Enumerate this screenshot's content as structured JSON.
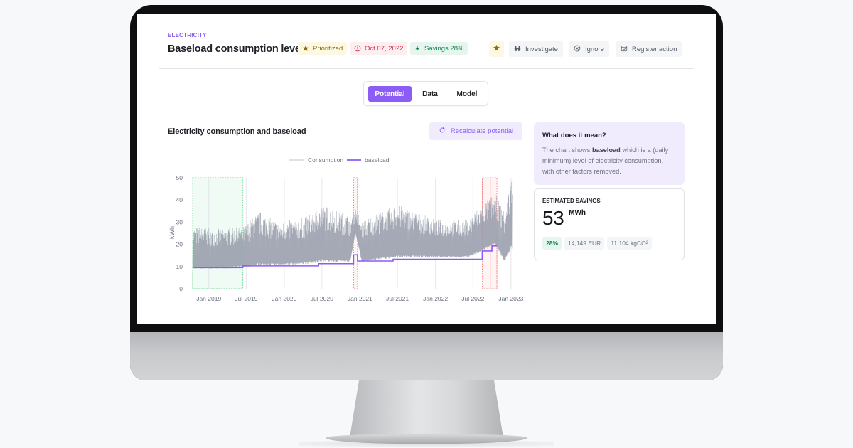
{
  "header": {
    "category": "ELECTRICITY",
    "title": "Baseload consumption level",
    "badges": {
      "prioritized": "Prioritized",
      "date": "Oct 07, 2022",
      "savings": "Savings 28%"
    },
    "actions": {
      "investigate": "Investigate",
      "ignore": "Ignore",
      "register": "Register action"
    }
  },
  "tabs": {
    "potential": "Potential",
    "data": "Data",
    "model": "Model",
    "active": "Potential"
  },
  "chart_panel": {
    "title": "Electricity consumption and baseload",
    "recalc_label": "Recalculate potential"
  },
  "info": {
    "title": "What does it mean?",
    "text_before": "The chart shows ",
    "text_bold": "baseload",
    "text_after": " which is a (daily minimum) level of electricity consumption, with other factors removed."
  },
  "savings": {
    "label": "ESTIMATED SAVINGS",
    "value": "53",
    "unit": "MWh",
    "percent": "28%",
    "eur": "14,149 EUR",
    "co2_value": "11,104 kgCO",
    "co2_sup": "2"
  },
  "colors": {
    "accent": "#8b5cf6",
    "consumption": "#9aa0ad",
    "baseline_region": "#22c55e",
    "anomaly_region": "#ef4444"
  },
  "chart_data": {
    "type": "line",
    "title": "Electricity consumption and baseload",
    "ylabel": "kWh",
    "xlabel": "",
    "ylim": [
      0,
      50
    ],
    "xlim": [
      "2018-10-15",
      "2023-01-05"
    ],
    "yticks": [
      "0",
      "10",
      "20",
      "30",
      "40",
      "50"
    ],
    "xticks": [
      {
        "label": "Jan 2019",
        "date": "2019-01-01"
      },
      {
        "label": "Jul 2019",
        "date": "2019-07-01"
      },
      {
        "label": "Jan 2020",
        "date": "2020-01-01"
      },
      {
        "label": "Jul 2020",
        "date": "2020-07-01"
      },
      {
        "label": "Jan 2021",
        "date": "2021-01-01"
      },
      {
        "label": "Jul 2021",
        "date": "2021-07-01"
      },
      {
        "label": "Jan 2022",
        "date": "2022-01-01"
      },
      {
        "label": "Jul 2022",
        "date": "2022-07-01"
      },
      {
        "label": "Jan 2023",
        "date": "2023-01-01"
      }
    ],
    "grid": "vertical",
    "legend": {
      "position": "top-center",
      "entries": [
        "Consumption",
        "baseload"
      ]
    },
    "series": [
      {
        "name": "Consumption",
        "note": "hourly consumption envelope (approx. min/max band)",
        "envelope": [
          {
            "date": "2018-10-15",
            "min": 9,
            "max": 28
          },
          {
            "date": "2019-03-01",
            "min": 9,
            "max": 27
          },
          {
            "date": "2019-06-15",
            "min": 9.5,
            "max": 28
          },
          {
            "date": "2019-09-01",
            "min": 10.5,
            "max": 35
          },
          {
            "date": "2019-12-01",
            "min": 10.5,
            "max": 30
          },
          {
            "date": "2020-04-01",
            "min": 11,
            "max": 32
          },
          {
            "date": "2020-07-01",
            "min": 12,
            "max": 38
          },
          {
            "date": "2020-11-15",
            "min": 12,
            "max": 33
          },
          {
            "date": "2020-12-10",
            "min": 25,
            "max": 36
          },
          {
            "date": "2021-01-10",
            "min": 12,
            "max": 31
          },
          {
            "date": "2021-07-01",
            "min": 14,
            "max": 38
          },
          {
            "date": "2022-01-01",
            "min": 14,
            "max": 31
          },
          {
            "date": "2022-06-01",
            "min": 14,
            "max": 31
          },
          {
            "date": "2022-08-01",
            "min": 16,
            "max": 37
          },
          {
            "date": "2022-10-15",
            "min": 20,
            "max": 43
          },
          {
            "date": "2022-12-01",
            "min": 12,
            "max": 34
          },
          {
            "date": "2022-12-31",
            "min": 18,
            "max": 50
          }
        ]
      },
      {
        "name": "baseload",
        "steps": [
          {
            "from": "2018-10-15",
            "to": "2019-06-15",
            "value": 9.5
          },
          {
            "from": "2019-06-15",
            "to": "2020-06-15",
            "value": 10.3
          },
          {
            "from": "2020-06-15",
            "to": "2020-12-01",
            "value": 11.3
          },
          {
            "from": "2020-12-01",
            "to": "2020-12-20",
            "value": 15.3
          },
          {
            "from": "2020-12-20",
            "to": "2021-06-10",
            "value": 12.5
          },
          {
            "from": "2021-06-10",
            "to": "2022-08-15",
            "value": 13.3
          },
          {
            "from": "2022-08-15",
            "to": "2022-10-01",
            "value": 17
          },
          {
            "from": "2022-10-01",
            "to": "2022-10-25",
            "value": 19.3
          }
        ]
      }
    ],
    "regions": [
      {
        "type": "baseline",
        "from": "2018-10-15",
        "to": "2019-06-15"
      },
      {
        "type": "anomaly",
        "from": "2020-12-01",
        "to": "2020-12-20"
      },
      {
        "type": "anomaly",
        "from": "2022-08-15",
        "to": "2022-10-25"
      }
    ]
  }
}
